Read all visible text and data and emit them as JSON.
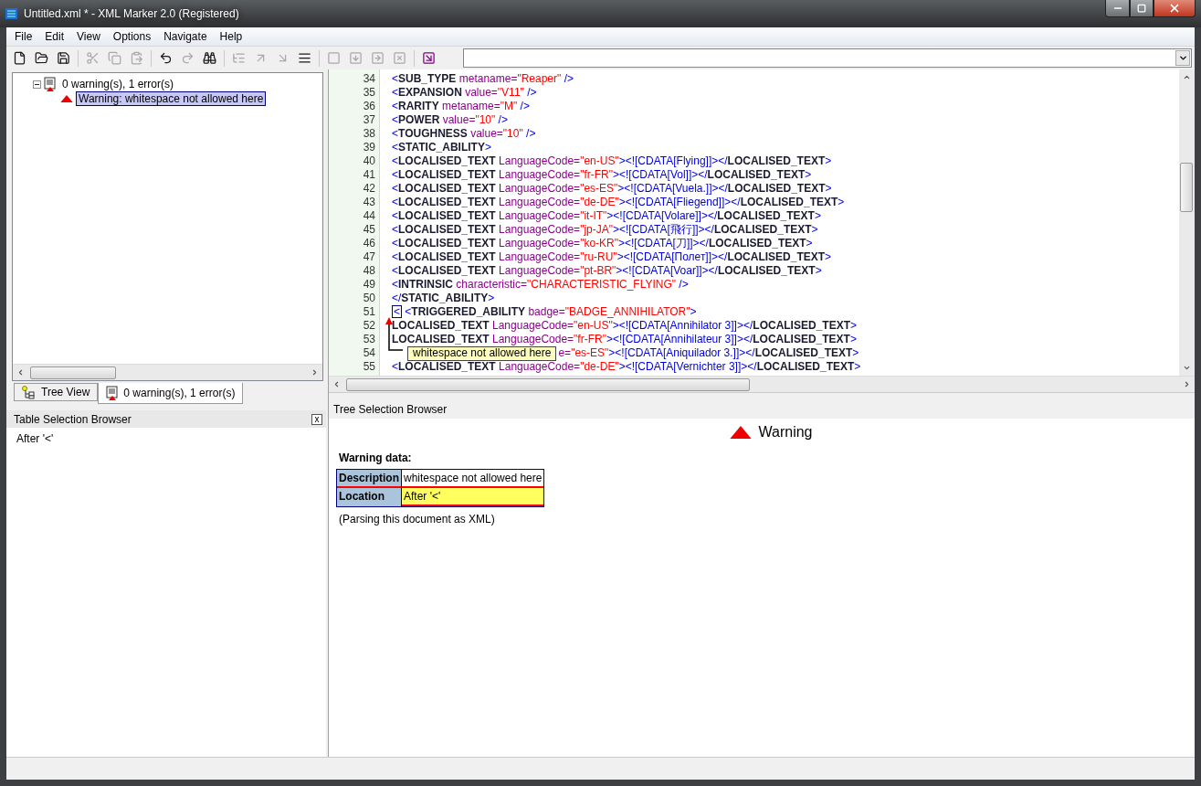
{
  "window": {
    "title": "Untitled.xml * - XML Marker 2.0 (Registered)"
  },
  "menu": [
    "File",
    "Edit",
    "View",
    "Options",
    "Navigate",
    "Help"
  ],
  "toolbar": [
    {
      "kind": "new",
      "disabled": false
    },
    {
      "kind": "open",
      "disabled": false
    },
    {
      "kind": "save",
      "disabled": false
    },
    {
      "kind": "sep"
    },
    {
      "kind": "cut",
      "disabled": true
    },
    {
      "kind": "copy",
      "disabled": true
    },
    {
      "kind": "paste",
      "disabled": true
    },
    {
      "kind": "sep"
    },
    {
      "kind": "undo",
      "disabled": false
    },
    {
      "kind": "redo",
      "disabled": true
    },
    {
      "kind": "find",
      "disabled": false
    },
    {
      "kind": "sep"
    },
    {
      "kind": "tree",
      "disabled": true
    },
    {
      "kind": "up",
      "disabled": true
    },
    {
      "kind": "down",
      "disabled": true
    },
    {
      "kind": "indent",
      "disabled": false
    },
    {
      "kind": "sep"
    },
    {
      "kind": "block",
      "disabled": true
    },
    {
      "kind": "block-down",
      "disabled": true
    },
    {
      "kind": "block-right",
      "disabled": true
    },
    {
      "kind": "block-x",
      "disabled": true
    },
    {
      "kind": "sep"
    },
    {
      "kind": "goto",
      "disabled": false
    }
  ],
  "tree": [
    {
      "label": "0 warning(s), 1 error(s)",
      "kind": "errors",
      "expanded": true,
      "selected": false,
      "children": [
        {
          "label": "Warning: whitespace not allowed here",
          "kind": "warning",
          "selected": true
        }
      ]
    }
  ],
  "left_tabs": [
    {
      "label": "Tree View",
      "kind": "tree",
      "selected": false
    },
    {
      "label": "0 warning(s), 1 error(s)",
      "kind": "errors",
      "selected": true
    }
  ],
  "table_browser": {
    "title": "Table Selection Browser",
    "close": "x",
    "content": "After '<'"
  },
  "editor": {
    "lines": [
      {
        "number": "34",
        "segments": [
          {
            "kind": "p",
            "text": "<"
          },
          {
            "kind": "t",
            "text": "SUB_TYPE"
          },
          {
            "kind": "a",
            "text": " metaname="
          },
          {
            "kind": "v",
            "text": "\"Reaper\""
          },
          {
            "kind": "p",
            "text": " />"
          }
        ]
      },
      {
        "number": "35",
        "segments": [
          {
            "kind": "p",
            "text": "<"
          },
          {
            "kind": "t",
            "text": "EXPANSION"
          },
          {
            "kind": "a",
            "text": " value="
          },
          {
            "kind": "v",
            "text": "\"V11\""
          },
          {
            "kind": "p",
            "text": " />"
          }
        ]
      },
      {
        "number": "36",
        "segments": [
          {
            "kind": "p",
            "text": "<"
          },
          {
            "kind": "t",
            "text": "RARITY"
          },
          {
            "kind": "a",
            "text": " metaname="
          },
          {
            "kind": "v",
            "text": "\"M\""
          },
          {
            "kind": "p",
            "text": " />"
          }
        ]
      },
      {
        "number": "37",
        "segments": [
          {
            "kind": "p",
            "text": "<"
          },
          {
            "kind": "t",
            "text": "POWER"
          },
          {
            "kind": "a",
            "text": " value="
          },
          {
            "kind": "v",
            "text": "\"10\""
          },
          {
            "kind": "p",
            "text": " />"
          }
        ]
      },
      {
        "number": "38",
        "segments": [
          {
            "kind": "p",
            "text": "<"
          },
          {
            "kind": "t",
            "text": "TOUGHNESS"
          },
          {
            "kind": "a",
            "text": " value="
          },
          {
            "kind": "v",
            "text": "\"10\""
          },
          {
            "kind": "p",
            "text": " />"
          }
        ]
      },
      {
        "number": "39",
        "segments": [
          {
            "kind": "p",
            "text": "<"
          },
          {
            "kind": "t",
            "text": "STATIC_ABILITY"
          },
          {
            "kind": "p",
            "text": ">"
          }
        ]
      },
      {
        "number": "40",
        "segments": [
          {
            "kind": "p",
            "text": "<"
          },
          {
            "kind": "t",
            "text": "LOCALISED_TEXT"
          },
          {
            "kind": "a",
            "text": " LanguageCode="
          },
          {
            "kind": "v",
            "text": "\"en-US\""
          },
          {
            "kind": "p",
            "text": "><![CDATA[Flying]]></"
          },
          {
            "kind": "t",
            "text": "LOCALISED_TEXT"
          },
          {
            "kind": "p",
            "text": ">"
          }
        ]
      },
      {
        "number": "41",
        "segments": [
          {
            "kind": "p",
            "text": "<"
          },
          {
            "kind": "t",
            "text": "LOCALISED_TEXT"
          },
          {
            "kind": "a",
            "text": " LanguageCode="
          },
          {
            "kind": "v",
            "text": "\"fr-FR\""
          },
          {
            "kind": "p",
            "text": "><![CDATA[Vol]]></"
          },
          {
            "kind": "t",
            "text": "LOCALISED_TEXT"
          },
          {
            "kind": "p",
            "text": ">"
          }
        ]
      },
      {
        "number": "42",
        "segments": [
          {
            "kind": "p",
            "text": "<"
          },
          {
            "kind": "t",
            "text": "LOCALISED_TEXT"
          },
          {
            "kind": "a",
            "text": " LanguageCode="
          },
          {
            "kind": "v",
            "text": "\"es-ES\""
          },
          {
            "kind": "p",
            "text": "><![CDATA[Vuela.]]></"
          },
          {
            "kind": "t",
            "text": "LOCALISED_TEXT"
          },
          {
            "kind": "p",
            "text": ">"
          }
        ]
      },
      {
        "number": "43",
        "segments": [
          {
            "kind": "p",
            "text": "<"
          },
          {
            "kind": "t",
            "text": "LOCALISED_TEXT"
          },
          {
            "kind": "a",
            "text": " LanguageCode="
          },
          {
            "kind": "v",
            "text": "\"de-DE\""
          },
          {
            "kind": "p",
            "text": "><![CDATA[Fliegend]]></"
          },
          {
            "kind": "t",
            "text": "LOCALISED_TEXT"
          },
          {
            "kind": "p",
            "text": ">"
          }
        ]
      },
      {
        "number": "44",
        "segments": [
          {
            "kind": "p",
            "text": "<"
          },
          {
            "kind": "t",
            "text": "LOCALISED_TEXT"
          },
          {
            "kind": "a",
            "text": " LanguageCode="
          },
          {
            "kind": "v",
            "text": "\"it-IT\""
          },
          {
            "kind": "p",
            "text": "><![CDATA[Volare]]></"
          },
          {
            "kind": "t",
            "text": "LOCALISED_TEXT"
          },
          {
            "kind": "p",
            "text": ">"
          }
        ]
      },
      {
        "number": "45",
        "segments": [
          {
            "kind": "p",
            "text": "<"
          },
          {
            "kind": "t",
            "text": "LOCALISED_TEXT"
          },
          {
            "kind": "a",
            "text": " LanguageCode="
          },
          {
            "kind": "v",
            "text": "\"jp-JA\""
          },
          {
            "kind": "p",
            "text": "><![CDATA[飛行]]></"
          },
          {
            "kind": "t",
            "text": "LOCALISED_TEXT"
          },
          {
            "kind": "p",
            "text": ">"
          }
        ]
      },
      {
        "number": "46",
        "segments": [
          {
            "kind": "p",
            "text": "<"
          },
          {
            "kind": "t",
            "text": "LOCALISED_TEXT"
          },
          {
            "kind": "a",
            "text": " LanguageCode="
          },
          {
            "kind": "v",
            "text": "\"ko-KR\""
          },
          {
            "kind": "p",
            "text": "><![CDATA[刀]]></"
          },
          {
            "kind": "t",
            "text": "LOCALISED_TEXT"
          },
          {
            "kind": "p",
            "text": ">"
          }
        ]
      },
      {
        "number": "47",
        "segments": [
          {
            "kind": "p",
            "text": "<"
          },
          {
            "kind": "t",
            "text": "LOCALISED_TEXT"
          },
          {
            "kind": "a",
            "text": " LanguageCode="
          },
          {
            "kind": "v",
            "text": "\"ru-RU\""
          },
          {
            "kind": "p",
            "text": "><![CDATA[Полет]]></"
          },
          {
            "kind": "t",
            "text": "LOCALISED_TEXT"
          },
          {
            "kind": "p",
            "text": ">"
          }
        ]
      },
      {
        "number": "48",
        "segments": [
          {
            "kind": "p",
            "text": "<"
          },
          {
            "kind": "t",
            "text": "LOCALISED_TEXT"
          },
          {
            "kind": "a",
            "text": " LanguageCode="
          },
          {
            "kind": "v",
            "text": "\"pt-BR\""
          },
          {
            "kind": "p",
            "text": "><![CDATA[Voar]]></"
          },
          {
            "kind": "t",
            "text": "LOCALISED_TEXT"
          },
          {
            "kind": "p",
            "text": ">"
          }
        ]
      },
      {
        "number": "49",
        "segments": [
          {
            "kind": "p",
            "text": "<"
          },
          {
            "kind": "t",
            "text": "INTRINSIC"
          },
          {
            "kind": "a",
            "text": " characteristic="
          },
          {
            "kind": "v",
            "text": "\"CHARACTERISTIC_FLYING\""
          },
          {
            "kind": "p",
            "text": " />"
          }
        ]
      },
      {
        "number": "50",
        "segments": [
          {
            "kind": "p",
            "text": "</"
          },
          {
            "kind": "t",
            "text": "STATIC_ABILITY"
          },
          {
            "kind": "p",
            "text": ">"
          }
        ]
      },
      {
        "number": "51",
        "segments": [
          {
            "kind": "error",
            "text": "<"
          },
          {
            "kind": "p",
            "text": " <"
          },
          {
            "kind": "t",
            "text": "TRIGGERED_ABILITY"
          },
          {
            "kind": "a",
            "text": " badge="
          },
          {
            "kind": "v",
            "text": "\"BADGE_ANNIHILATOR\""
          },
          {
            "kind": "p",
            "text": ">"
          }
        ]
      },
      {
        "number": "52",
        "segments": [
          {
            "kind": "t",
            "text": "LOCALISED_TEXT"
          },
          {
            "kind": "a",
            "text": " LanguageCode="
          },
          {
            "kind": "v",
            "text": "\"en-US\""
          },
          {
            "kind": "p",
            "text": "><![CDATA[Annihilator 3]]></"
          },
          {
            "kind": "t",
            "text": "LOCALISED_TEXT"
          },
          {
            "kind": "p",
            "text": ">"
          }
        ]
      },
      {
        "number": "53",
        "segments": [
          {
            "kind": "t",
            "text": "LOCALISED_TEXT"
          },
          {
            "kind": "a",
            "text": " LanguageCode="
          },
          {
            "kind": "v",
            "text": "\"fr-FR\""
          },
          {
            "kind": "p",
            "text": "><![CDATA[Annihilateur 3]]></"
          },
          {
            "kind": "t",
            "text": "LOCALISED_TEXT"
          },
          {
            "kind": "p",
            "text": ">"
          }
        ]
      },
      {
        "number": "54",
        "segments": [
          {
            "kind": "tooltip",
            "text": "whitespace not allowed here"
          },
          {
            "kind": "a",
            "text": "e="
          },
          {
            "kind": "v",
            "text": "\"es-ES\""
          },
          {
            "kind": "p",
            "text": "><![CDATA[Aniquilador 3.]]></"
          },
          {
            "kind": "t",
            "text": "LOCALISED_TEXT"
          },
          {
            "kind": "p",
            "text": ">"
          }
        ]
      },
      {
        "number": "55",
        "segments": [
          {
            "kind": "p",
            "text": "<"
          },
          {
            "kind": "t",
            "text": "LOCALISED_TEXT"
          },
          {
            "kind": "a",
            "text": " LanguageCode="
          },
          {
            "kind": "v",
            "text": "\"de-DE\""
          },
          {
            "kind": "p",
            "text": "><![CDATA[Vernichter 3]]></"
          },
          {
            "kind": "t",
            "text": "LOCALISED_TEXT"
          },
          {
            "kind": "p",
            "text": ">"
          }
        ]
      }
    ]
  },
  "tree_browser": {
    "title": "Tree Selection Browser",
    "heading": "Warning",
    "data_title": "Warning data:",
    "rows": [
      {
        "label": "Description",
        "value": "whitespace not allowed here",
        "highlighted": false
      },
      {
        "label": "Location",
        "value": "After '<'",
        "highlighted": true
      }
    ],
    "note": "(Parsing this document as XML)"
  }
}
